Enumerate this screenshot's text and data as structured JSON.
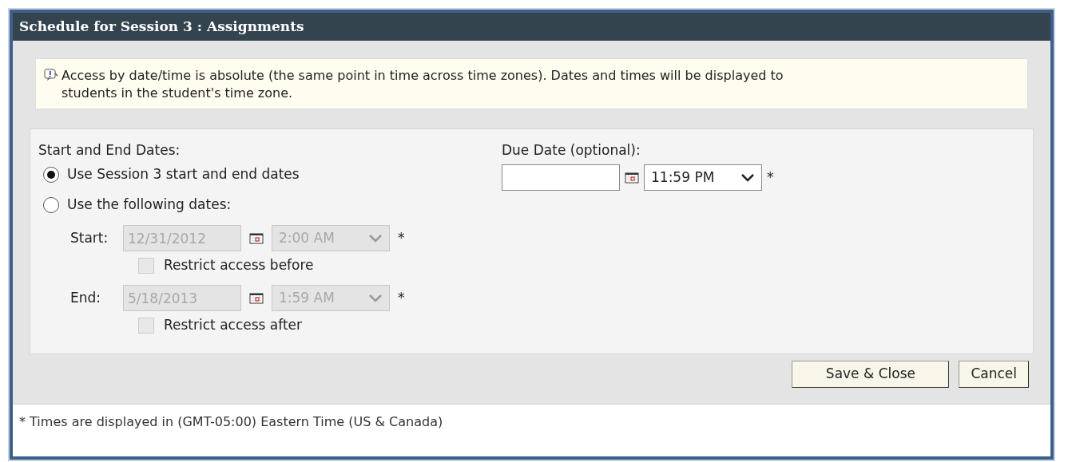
{
  "dialog": {
    "title": "Schedule for Session 3 : Assignments"
  },
  "notice": "Access by date/time is absolute (the same point in time across time zones). Dates and times will be displayed to students in the student's time zone.",
  "start_end": {
    "label": "Start and End Dates:",
    "options": [
      {
        "label": "Use Session 3 start and end dates",
        "selected": true
      },
      {
        "label": "Use the following dates:",
        "selected": false
      }
    ],
    "ranges": [
      {
        "label": "Start:",
        "date": "12/31/2012",
        "time": "2:00 AM",
        "required": "*",
        "disabled": true,
        "restrict_label": "Restrict access before",
        "checked": false
      },
      {
        "label": "End:",
        "date": "5/18/2013",
        "time": "1:59 AM",
        "required": "*",
        "disabled": true,
        "restrict_label": "Restrict access after",
        "checked": false
      }
    ]
  },
  "due_date": {
    "label": "Due Date (optional):",
    "time": "11:59 PM",
    "required": "*"
  },
  "buttons": [
    "Save & Close",
    "Cancel"
  ],
  "footnote": "* Times are displayed in (GMT-05:00) Eastern Time (US & Canada)"
}
